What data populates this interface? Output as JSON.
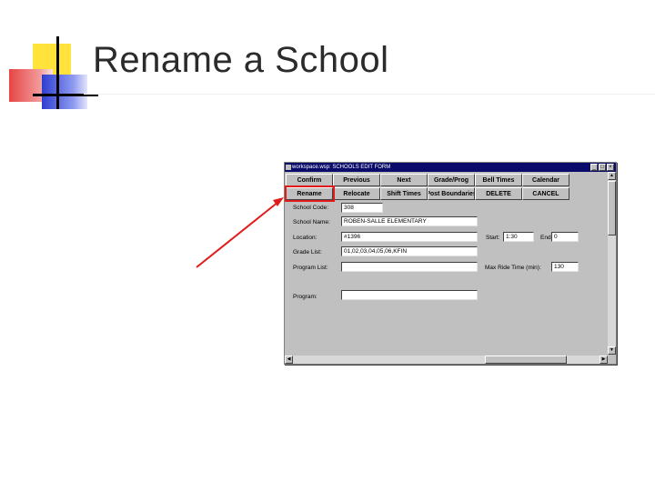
{
  "slide": {
    "title": "Rename a School"
  },
  "window": {
    "title": "workspace.wsp: SCHOOLS EDIT FORM",
    "controls": [
      "_",
      "□",
      "×"
    ]
  },
  "toolbar": {
    "row1": [
      "Confirm",
      "Previous",
      "Next",
      "Grade/Prog",
      "Bell Times",
      "Calendar"
    ],
    "row2": [
      "Rename",
      "Relocate",
      "Shift Times",
      "Post Boundaries",
      "DELETE",
      "CANCEL"
    ]
  },
  "form": {
    "school_code_label": "School Code:",
    "school_code_value": "308",
    "school_name_label": "School Name:",
    "school_name_value": "ROBEN-SALLE ELEMENTARY",
    "location_label": "Location:",
    "location_value": "#1396",
    "grades_label": "Grade List:",
    "grades_value": "01,02,03,04,05,06,KFIN",
    "program_list_label": "Program List:",
    "program_list_value": "",
    "program_label": "Program:",
    "program_value": "",
    "start_label": "Start:",
    "start_value": "1:30",
    "end_label": "End:",
    "end_value": "0",
    "max_ride_label": "Max Ride Time (min):",
    "max_ride_value": "130"
  },
  "colors": {
    "highlight": "#e01b1b",
    "titlebar": "#0a0a6b",
    "window_bg": "#c0c0c0"
  }
}
